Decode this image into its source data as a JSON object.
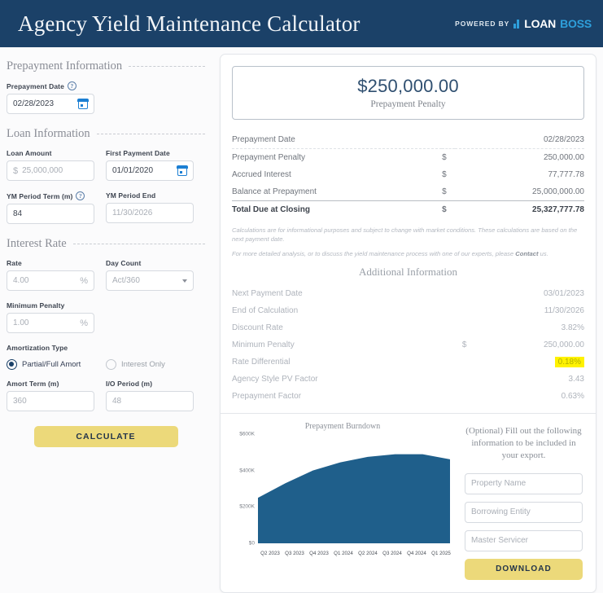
{
  "header": {
    "title": "Agency Yield Maintenance Calculator",
    "powered_by": "POWERED BY",
    "brand_first": "LOAN",
    "brand_second": "BOSS",
    "bg_color": "#1b4168",
    "brand_accent": "#2e9fdb"
  },
  "form": {
    "sections": {
      "prepayment": "Prepayment Information",
      "loan": "Loan Information",
      "interest": "Interest Rate"
    },
    "prepayment_date": {
      "label": "Prepayment Date",
      "value": "02/28/2023"
    },
    "loan_amount": {
      "label": "Loan Amount",
      "prefix": "$",
      "value": "25,000,000"
    },
    "first_payment_date": {
      "label": "First Payment Date",
      "value": "01/01/2020"
    },
    "ym_period_term": {
      "label": "YM Period Term (m)",
      "value": "84"
    },
    "ym_period_end": {
      "label": "YM Period End",
      "value": "11/30/2026"
    },
    "rate": {
      "label": "Rate",
      "value": "4.00",
      "suffix": "%"
    },
    "day_count": {
      "label": "Day Count",
      "value": "Act/360"
    },
    "minimum_penalty": {
      "label": "Minimum Penalty",
      "value": "1.00",
      "suffix": "%"
    },
    "amortization_type": {
      "label": "Amortization Type",
      "options": [
        "Partial/Full Amort",
        "Interest Only"
      ],
      "selected": "Partial/Full Amort"
    },
    "amort_term": {
      "label": "Amort Term (m)",
      "value": "360"
    },
    "io_period": {
      "label": "I/O Period (m)",
      "value": "48"
    },
    "calculate_button": "CALCULATE"
  },
  "results": {
    "hero_amount": "$250,000.00",
    "hero_label": "Prepayment Penalty",
    "summary_rows": [
      {
        "label": "Prepayment Date",
        "currency": "",
        "value": "02/28/2023"
      },
      {
        "label": "Prepayment Penalty",
        "currency": "$",
        "value": "250,000.00"
      },
      {
        "label": "Accrued Interest",
        "currency": "$",
        "value": "77,777.78"
      },
      {
        "label": "Balance at Prepayment",
        "currency": "$",
        "value": "25,000,000.00"
      },
      {
        "label": "Total Due at Closing",
        "currency": "$",
        "value": "25,327,777.78"
      }
    ],
    "disclaimer_1": "Calculations are for informational purposes and subject to change with market conditions. These calculations are based on the next payment date.",
    "disclaimer_2_pre": "For more detailed analysis, or to discuss the yield maintenance process with one of our experts, please ",
    "disclaimer_2_link": "Contact",
    "disclaimer_2_post": " us.",
    "additional_title": "Additional Information",
    "additional_rows": [
      {
        "label": "Next Payment Date",
        "currency": "",
        "value": "03/01/2023",
        "highlight": false
      },
      {
        "label": "End of Calculation",
        "currency": "",
        "value": "11/30/2026",
        "highlight": false
      },
      {
        "label": "Discount Rate",
        "currency": "",
        "value": "3.82%",
        "highlight": false
      },
      {
        "label": "Minimum Penalty",
        "currency": "$",
        "value": "250,000.00",
        "highlight": false
      },
      {
        "label": "Rate Differential",
        "currency": "",
        "value": "0.18%",
        "highlight": true
      },
      {
        "label": "Agency Style PV Factor",
        "currency": "",
        "value": "3.43",
        "highlight": false
      },
      {
        "label": "Prepayment Factor",
        "currency": "",
        "value": "0.63%",
        "highlight": false
      }
    ],
    "highlight_color": "#fff200"
  },
  "export": {
    "note": "(Optional) Fill out the following information to be included in your export.",
    "property_name_placeholder": "Property Name",
    "borrowing_entity_placeholder": "Borrowing Entity",
    "master_servicer_placeholder": "Master Servicer",
    "download_button": "DOWNLOAD"
  },
  "chart_data": {
    "type": "area",
    "title": "Prepayment Burndown",
    "xlabel": "",
    "ylabel": "",
    "categories": [
      "Q2 2023",
      "Q3 2023",
      "Q4 2023",
      "Q1 2024",
      "Q2 2024",
      "Q3 2024",
      "Q4 2024",
      "Q1 2025"
    ],
    "values": [
      250000,
      330000,
      400000,
      445000,
      475000,
      490000,
      490000,
      462000
    ],
    "ylim": [
      0,
      600000
    ],
    "yticks": [
      0,
      200000,
      400000,
      600000
    ],
    "ytick_labels": [
      "$0",
      "$200K",
      "$400K",
      "$600K"
    ],
    "series_color": "#1f5f8b",
    "grid": false,
    "legend": "none"
  }
}
